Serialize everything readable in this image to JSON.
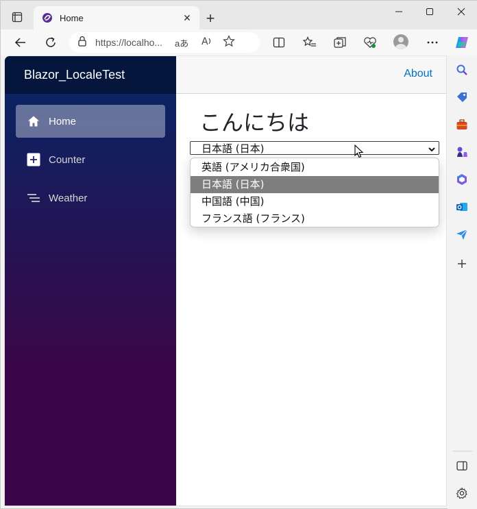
{
  "browser": {
    "tab_title": "Home",
    "tab_close": "✕",
    "new_tab": "+",
    "address": "https://localho...",
    "read_aloud_glyph": "aあ",
    "window_controls": [
      "minimize",
      "maximize",
      "close"
    ]
  },
  "app": {
    "brand": "Blazor_LocaleTest",
    "nav": [
      {
        "label": "Home",
        "icon": "home-icon",
        "active": true
      },
      {
        "label": "Counter",
        "icon": "plus-square-icon",
        "active": false
      },
      {
        "label": "Weather",
        "icon": "list-icon",
        "active": false
      }
    ],
    "about_link": "About",
    "heading": "こんにちは",
    "culture_select": {
      "selected": "日本語 (日本)",
      "options": [
        "英語 (アメリカ合衆国)",
        "日本語 (日本)",
        "中国語 (中国)",
        "フランス語 (フランス)"
      ]
    }
  },
  "colors": {
    "sidebar_top": "#052767",
    "sidebar_bottom": "#3a0647",
    "link": "#0071c1",
    "selected_option": "#7e7e7e"
  }
}
